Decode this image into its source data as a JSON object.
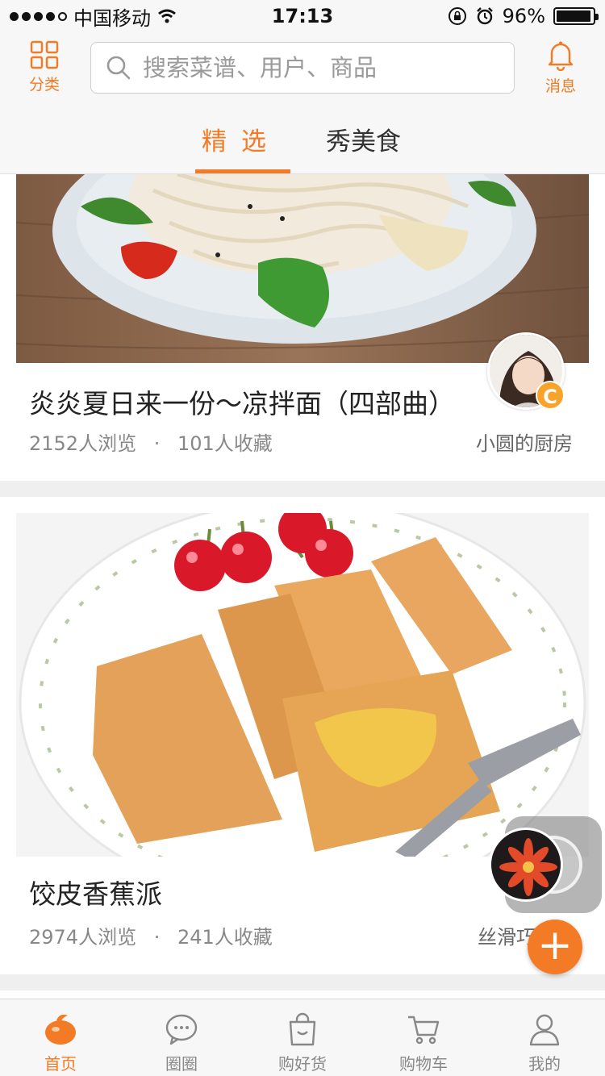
{
  "status_bar": {
    "carrier": "中国移动",
    "time": "17:13",
    "battery": "96%",
    "battery_level": 0.96
  },
  "header": {
    "category_label": "分类",
    "search_placeholder": "搜索菜谱、用户、商品",
    "messages_label": "消息",
    "tabs": [
      {
        "label": "精选",
        "active": true
      },
      {
        "label": "秀美食",
        "active": false
      }
    ]
  },
  "feed": [
    {
      "title": "炎炎夏日来一份～凉拌面（四部曲）",
      "views": "2152人浏览",
      "separator": "·",
      "favorites": "101人收藏",
      "author": "小圆的厨房",
      "author_badge": "C"
    },
    {
      "title": "饺皮香蕉派",
      "views": "2974人浏览",
      "separator": "·",
      "favorites": "241人收藏",
      "author": "丝滑巧"
    }
  ],
  "fab": {
    "label": "+"
  },
  "tabbar": [
    {
      "label": "首页",
      "active": true,
      "icon": "home-icon"
    },
    {
      "label": "圈圈",
      "active": false,
      "icon": "chat-icon"
    },
    {
      "label": "购好货",
      "active": false,
      "icon": "shopping-bag-icon"
    },
    {
      "label": "购物车",
      "active": false,
      "icon": "cart-icon"
    },
    {
      "label": "我的",
      "active": false,
      "icon": "user-icon"
    }
  ],
  "colors": {
    "accent": "#f47b25",
    "badge": "#f8a32a"
  }
}
